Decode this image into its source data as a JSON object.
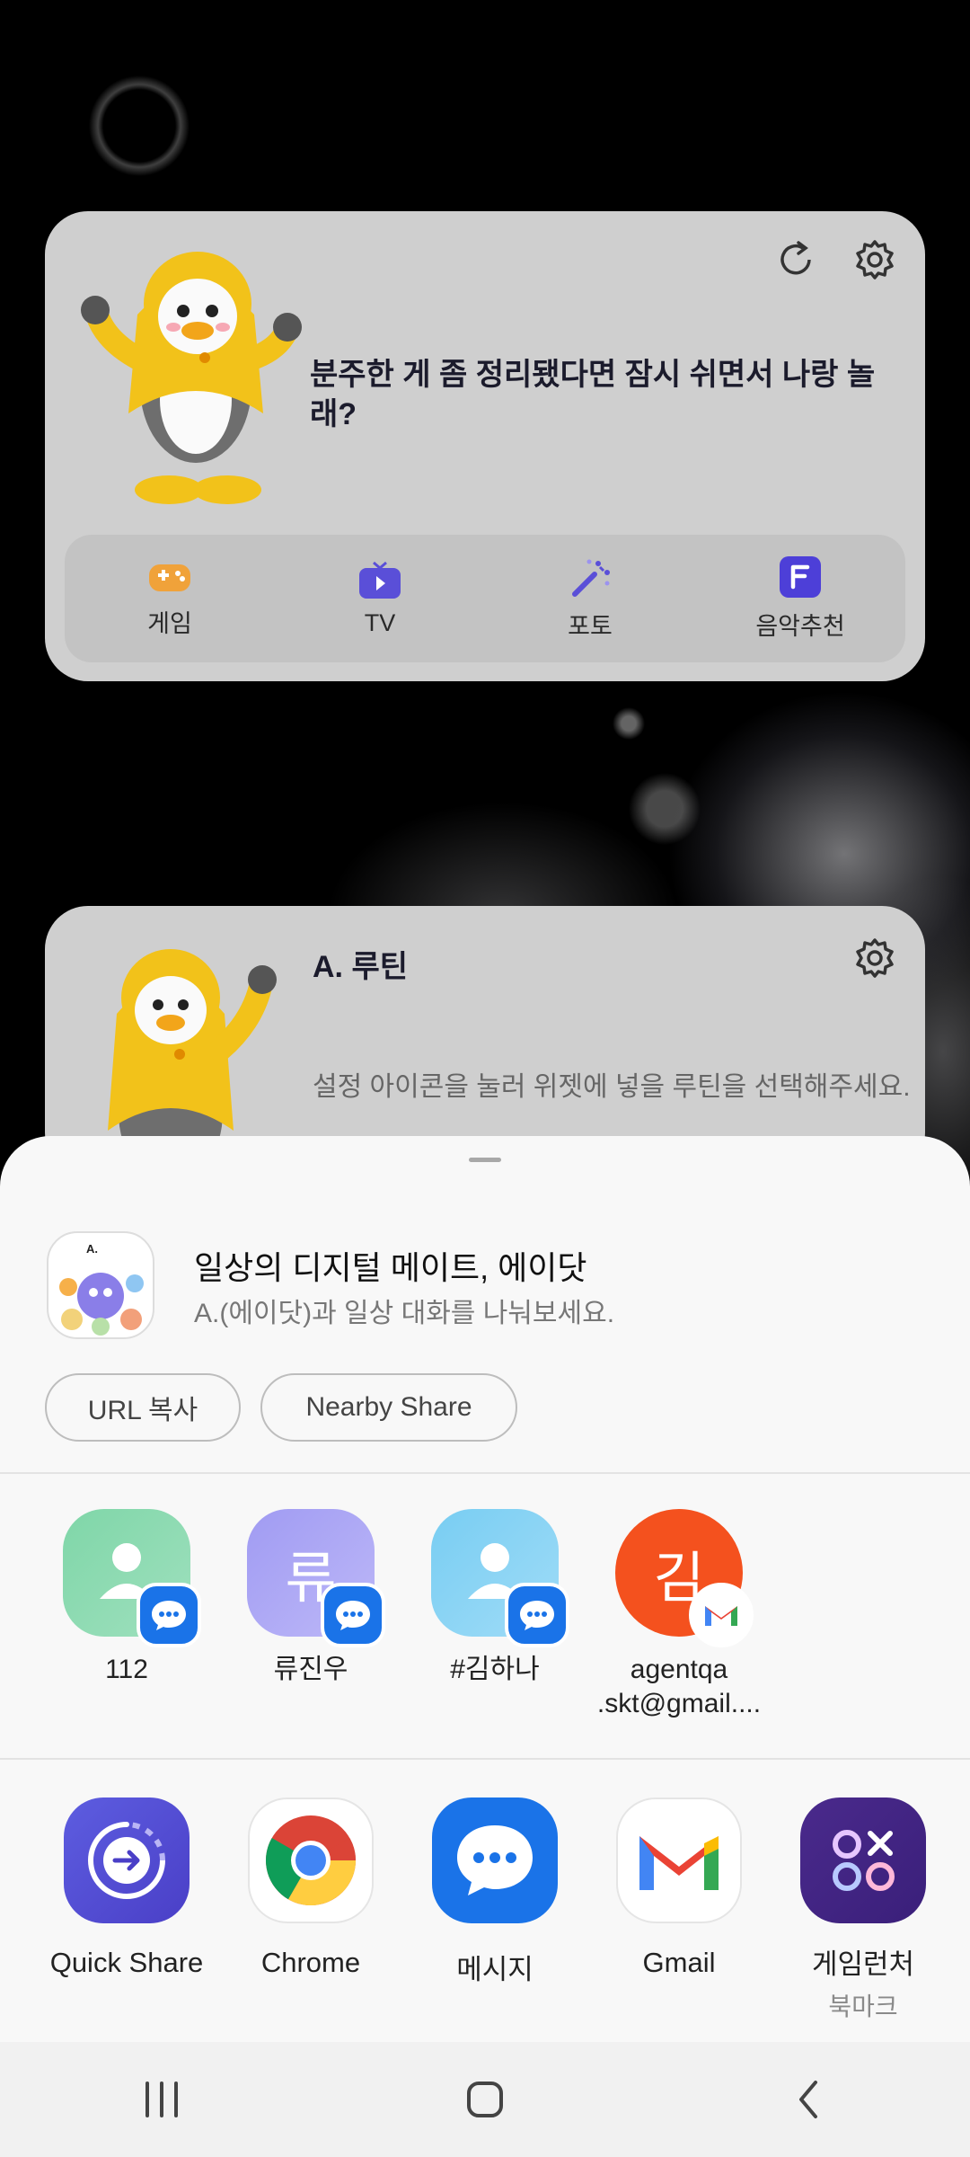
{
  "widget1": {
    "title": "분주한 게 좀 정리됐다면 잠시 쉬면서 나랑 놀래?",
    "menu": [
      {
        "label": "게임",
        "icon": "game-controller-icon"
      },
      {
        "label": "TV",
        "icon": "tv-icon"
      },
      {
        "label": "포토",
        "icon": "magic-wand-icon"
      },
      {
        "label": "음악추천",
        "icon": "music-flo-icon"
      }
    ]
  },
  "widget2": {
    "title": "A. 루틴",
    "description": "설정 아이콘을 눌러 위젯에 넣을 루틴을 선택해주세요."
  },
  "share": {
    "app_title": "일상의 디지털 메이트, 에이닷",
    "app_subtitle": "A.(에이닷)과 일상 대화를 나눠보세요.",
    "url_copy": "URL 복사",
    "nearby_share": "Nearby Share",
    "contacts": [
      {
        "name": "112",
        "color": "#8fdcb4"
      },
      {
        "name": "류진우",
        "initial": "류",
        "color": "#a9a6f5"
      },
      {
        "name": "#김하나",
        "color": "#86d1f3"
      },
      {
        "name_line1": "agentqa",
        "name_line2": ".skt@gmail....",
        "initial": "김",
        "color": "#f4511e"
      }
    ],
    "apps": [
      {
        "label": "Quick Share"
      },
      {
        "label": "Chrome"
      },
      {
        "label": "메시지"
      },
      {
        "label": "Gmail"
      },
      {
        "label": "게임런처",
        "sub": "북마크"
      }
    ]
  }
}
